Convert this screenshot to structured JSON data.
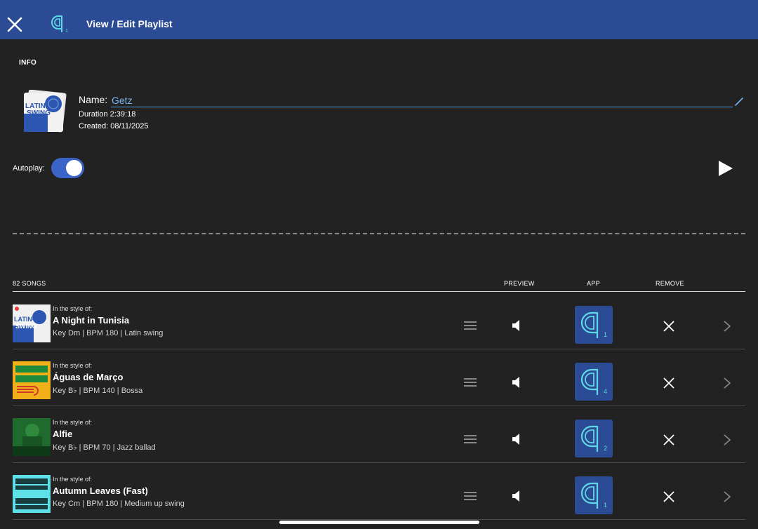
{
  "header": {
    "title": "View / Edit Playlist",
    "close_icon": "close-icon",
    "logo_icon": "q-app-logo-icon",
    "logo_badge": "1"
  },
  "info": {
    "section_label": "INFO",
    "cover_text_line1": "LATIN-",
    "cover_text_line2": "SWING",
    "name_label": "Name:",
    "name_value": "Getz",
    "duration": "Duration 2:39:18",
    "created": "Created: 08/11/2025",
    "autoplay_label": "Autoplay:",
    "autoplay_on": true
  },
  "list": {
    "count_label": "82 SONGS",
    "col_preview": "PREVIEW",
    "col_app": "APP",
    "col_remove": "REMOVE",
    "songs": [
      {
        "style_of": "In the style of:",
        "title": "A Night in Tunisia",
        "meta": "Key Dm | BPM 180 | Latin swing",
        "app_badge": "1",
        "thumb": "latin-swing-cover"
      },
      {
        "style_of": "In the style of:",
        "title": "Águas de Março",
        "meta": "Key B♭ | BPM 140 | Bossa",
        "app_badge": "4",
        "thumb": "bossa-cover"
      },
      {
        "style_of": "In the style of:",
        "title": "Alfie",
        "meta": "Key B♭ | BPM 70 | Jazz ballad",
        "app_badge": "2",
        "thumb": "ballad-cover"
      },
      {
        "style_of": "In the style of:",
        "title": "Autumn Leaves (Fast)",
        "meta": "Key Cm | BPM 180 | Medium up swing",
        "app_badge": "1",
        "thumb": "medium-up-cover"
      }
    ]
  },
  "colors": {
    "header_bg": "#2b4c94",
    "page_bg": "#222222",
    "accent_blue": "#79b4f2",
    "toggle_on": "#3a64c8",
    "app_teal": "#5fd8e6"
  }
}
